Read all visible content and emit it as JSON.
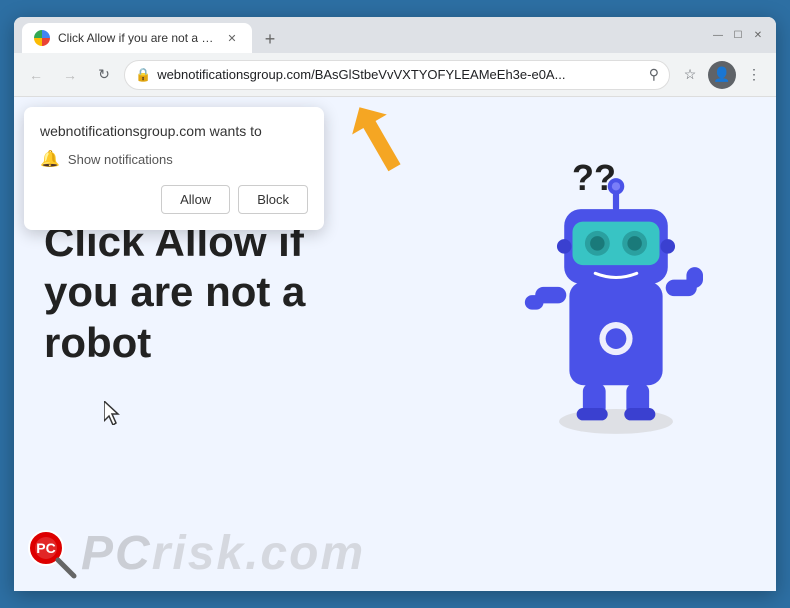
{
  "browser": {
    "tab": {
      "title": "Click Allow if you are not a robot",
      "favicon_alt": "site-favicon"
    },
    "new_tab_label": "+",
    "window_controls": {
      "minimize": "—",
      "maximize": "☐",
      "close": "✕"
    },
    "nav": {
      "back": "←",
      "forward": "→",
      "reload": "↻"
    },
    "address": {
      "lock_icon": "🔒",
      "url": "webnotificationsgroup.com/BAsGlStbeVvVXTYOFYLEAMeEh3e-e0A...",
      "url_short": "webnotificationsgroup.com/BAsGlStbeVvVXTYOFYLEAMeEh3e-e0A..."
    },
    "toolbar": {
      "search": "⚲",
      "bookmark": "☆",
      "profile": "👤",
      "menu": "⋮"
    }
  },
  "notification_popup": {
    "site_text": "webnotificationsgroup.com wants to",
    "notification_label": "Show notifications",
    "allow_button": "Allow",
    "block_button": "Block"
  },
  "page": {
    "main_text_line1": "Click Allow if",
    "main_text_line2": "you are not a",
    "main_text_line3": "robot",
    "question_marks": "??"
  },
  "watermark": {
    "text": "PCrisk.com",
    "pc": "PC",
    "risk": "risk.com"
  },
  "colors": {
    "browser_outer": "#2d6fa3",
    "page_bg": "#e8f0ff",
    "robot_blue": "#4a52e8",
    "robot_visor": "#38c4c4",
    "popup_bg": "#ffffff",
    "arrow_orange": "#f5a623"
  }
}
